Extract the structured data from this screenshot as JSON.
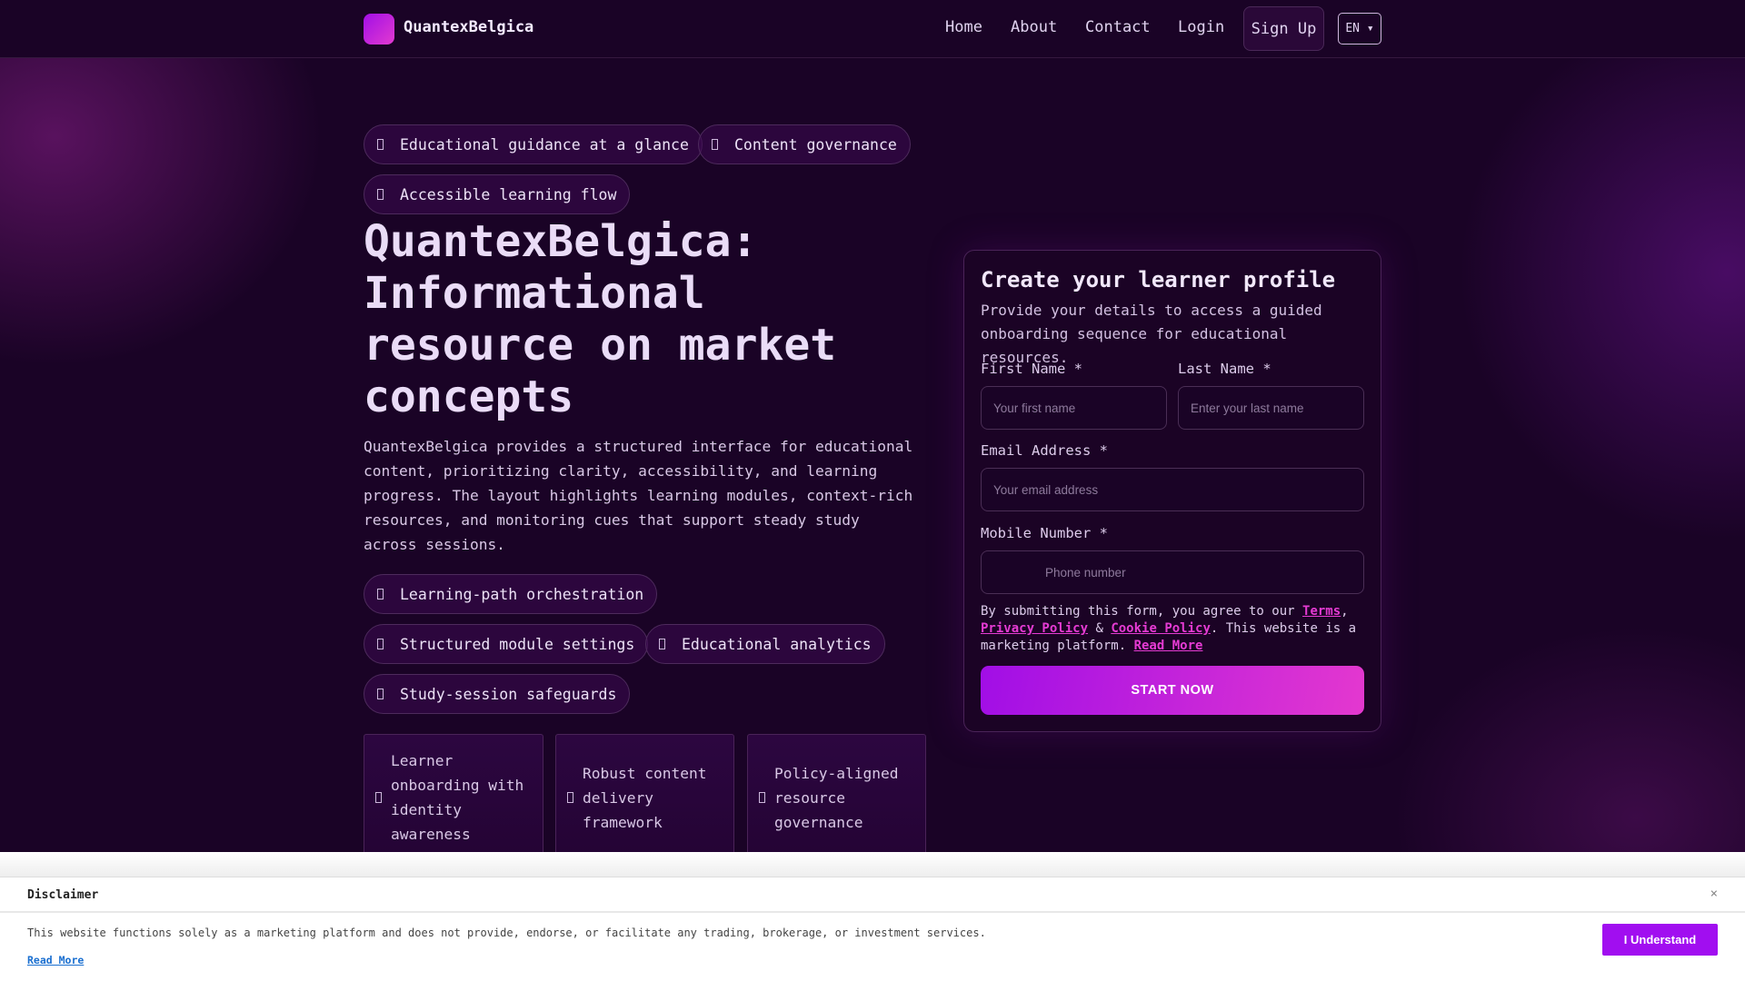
{
  "header": {
    "brand": "QuantexBelgica",
    "nav": [
      "Home",
      "About",
      "Contact",
      "Login"
    ],
    "signup": "Sign Up",
    "lang": "EN ▾"
  },
  "hero": {
    "badges": [
      "Educational guidance at a glance",
      "Content governance",
      "Accessible learning flow"
    ],
    "title": "QuantexBelgica: Informational resource on market concepts",
    "description": "QuantexBelgica provides a structured interface for educational content, prioritizing clarity, accessibility, and learning progress. The layout highlights learning modules, context-rich resources, and monitoring cues that support steady study across sessions.",
    "features": [
      "Learning-path orchestration",
      "Structured module settings",
      "Educational analytics",
      "Study-session safeguards"
    ],
    "cards": [
      "Learner onboarding with identity awareness",
      "Robust content delivery framework",
      "Policy-aligned resource governance"
    ]
  },
  "form": {
    "title": "Create your learner profile",
    "subtitle": "Provide your details to access a guided onboarding sequence for educational resources.",
    "first_label": "First Name *",
    "first_ph": "Your first name",
    "last_label": "Last Name *",
    "last_ph": "Enter your last name",
    "email_label": "Email Address *",
    "email_ph": "Your email address",
    "phone_label": "Mobile Number *",
    "phone_ph": "Phone number",
    "legal_1": "By submitting this form, you agree to our ",
    "terms": "Terms",
    "legal_2": ", ",
    "privacy": "Privacy Policy",
    "legal_3": " & ",
    "cookie": "Cookie Policy",
    "legal_4": ". This website is a marketing platform. ",
    "read_more": "Read More",
    "submit": "START NOW"
  },
  "disclaimer": {
    "title": "Disclaimer",
    "close": "×",
    "text": "This website functions solely as a marketing platform and does not provide, endorse, or facilitate any trading, brokerage, or investment services.",
    "read_more": "Read More",
    "button": "I Understand"
  }
}
